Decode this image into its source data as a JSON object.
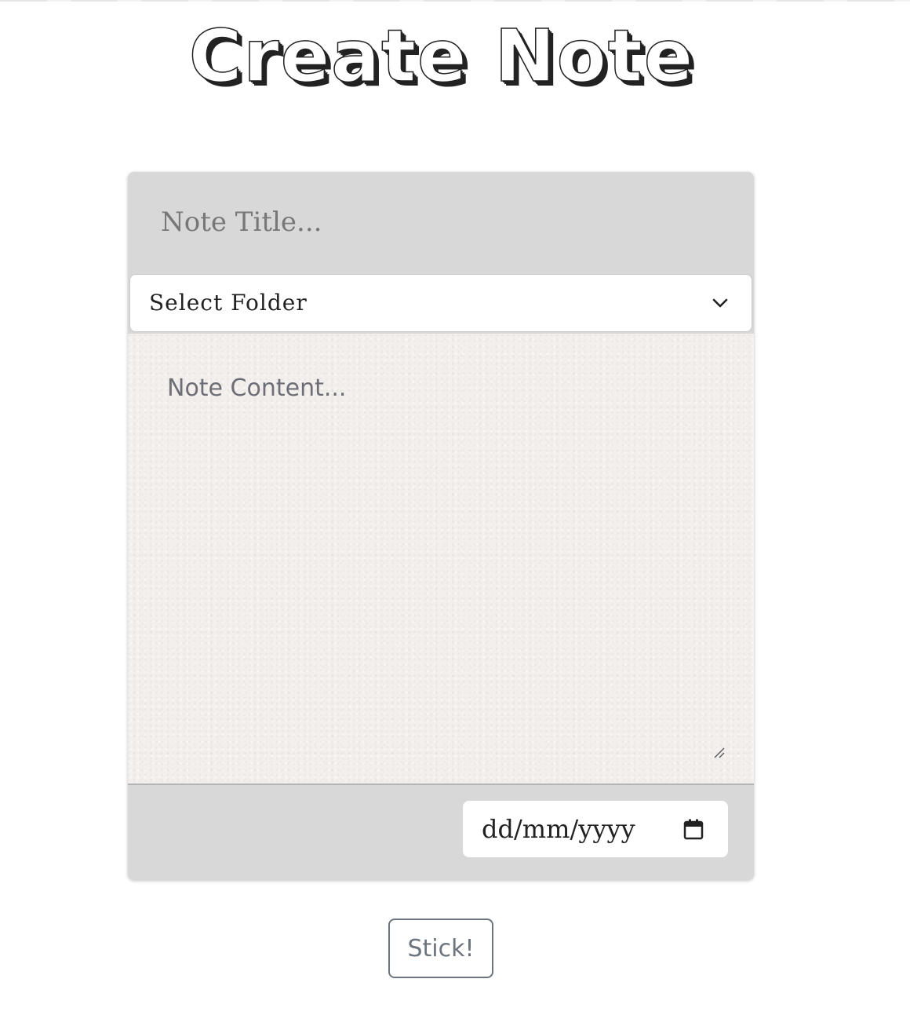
{
  "header": {
    "title": "Create Note"
  },
  "form": {
    "title_placeholder": "Note Title...",
    "folder_select": {
      "selected": "Select Folder",
      "icon": "chevron-down-icon"
    },
    "content_placeholder": "Note Content...",
    "date_field": {
      "placeholder": "dd/mm/yyyy",
      "icon": "calendar-icon"
    }
  },
  "actions": {
    "submit_label": "Stick!"
  },
  "colors": {
    "card_background": "#d8d8d8",
    "content_background": "#f3efed",
    "button_border": "#6c757d",
    "title_fill": "#ffffff",
    "title_outline": "#222222"
  }
}
